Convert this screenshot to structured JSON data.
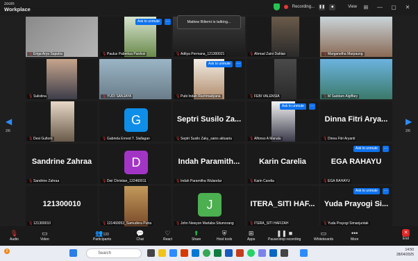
{
  "app": {
    "brand_line1": "zoom",
    "brand_line2": "Workplace",
    "recording": "Recording...",
    "view": "View"
  },
  "talking": "Mattew Biliemi is talking...",
  "unmute_label": "Ask to unmute",
  "nav": {
    "page_left": "2/6",
    "page_right": "2/6"
  },
  "tiles": [
    {
      "name": "Eriga Arya Saputra",
      "kind": "photo"
    },
    {
      "name": "Paulus Pabertua Pardosi",
      "kind": "photo"
    },
    {
      "name": "Aditya Permana_121300021",
      "kind": "photo"
    },
    {
      "name": "Ahmad Zaini Dahlan",
      "kind": "photo"
    },
    {
      "name": "Marganetha Marpaung",
      "kind": "photo"
    },
    {
      "name": "Sulistina",
      "kind": "photo"
    },
    {
      "name": "YUDI SANJAYA",
      "kind": "photo"
    },
    {
      "name": "Pubi Indah Rachmadyana",
      "kind": "photo"
    },
    {
      "name": "FEBI VALENSIA",
      "kind": "photo"
    },
    {
      "name": "M Saddam Algiffary",
      "kind": "photo"
    },
    {
      "name": "Desi Gultom",
      "kind": "photo"
    },
    {
      "name": "Gabriela Ernest T. Siallagan",
      "kind": "avatar",
      "letter": "G",
      "color": "#0e8ee8"
    },
    {
      "name": "Septri Susilo Zaky_sains aktuaria",
      "kind": "text",
      "big": "Septri Susilo Za..."
    },
    {
      "name": "Alfonso A Manalu",
      "kind": "photo"
    },
    {
      "name": "Dinna Fitri Aryanti",
      "kind": "text",
      "big": "Dinna Fitri Arya..."
    },
    {
      "name": "Sandrine Zahraa",
      "kind": "text",
      "big": "Sandrine Zahraa"
    },
    {
      "name": "Dwi Christian_122460011",
      "kind": "avatar",
      "letter": "D",
      "color": "#a335c6"
    },
    {
      "name": "Indah Paramitha Wulandar",
      "kind": "text",
      "big": "Indah Paramith..."
    },
    {
      "name": "Karin Carelia",
      "kind": "text",
      "big": "Karin Carelia"
    },
    {
      "name": "EGA RAHAYU",
      "kind": "text",
      "big": "EGA RAHAYU"
    },
    {
      "name": "121300010",
      "kind": "text",
      "big": "121300010"
    },
    {
      "name": "121460053_Samudera Putra",
      "kind": "photo"
    },
    {
      "name": "John Newyon Marlaba Situmorang",
      "kind": "avatar",
      "letter": "J",
      "color": "#4caf50"
    },
    {
      "name": "ITERA_SITI HAFIZAH",
      "kind": "text",
      "big": "ITERA_SITI HAF..."
    },
    {
      "name": "Yuda Prayogi Simanjuntak",
      "kind": "text",
      "big": "Yuda Prayogi Si..."
    }
  ],
  "toolbar": {
    "audio": "Audio",
    "video": "Video",
    "participants": "Participants",
    "participants_count": "133",
    "chat": "Chat",
    "react": "React",
    "share": "Share",
    "host_tools": "Host tools",
    "apps": "Apps",
    "pause": "Pause/stop recording",
    "whiteboards": "Whiteboards",
    "more": "More",
    "end": "End"
  },
  "taskbar": {
    "search": "Search",
    "time": "14:50",
    "date": "28/04/2025",
    "badge": "2"
  }
}
